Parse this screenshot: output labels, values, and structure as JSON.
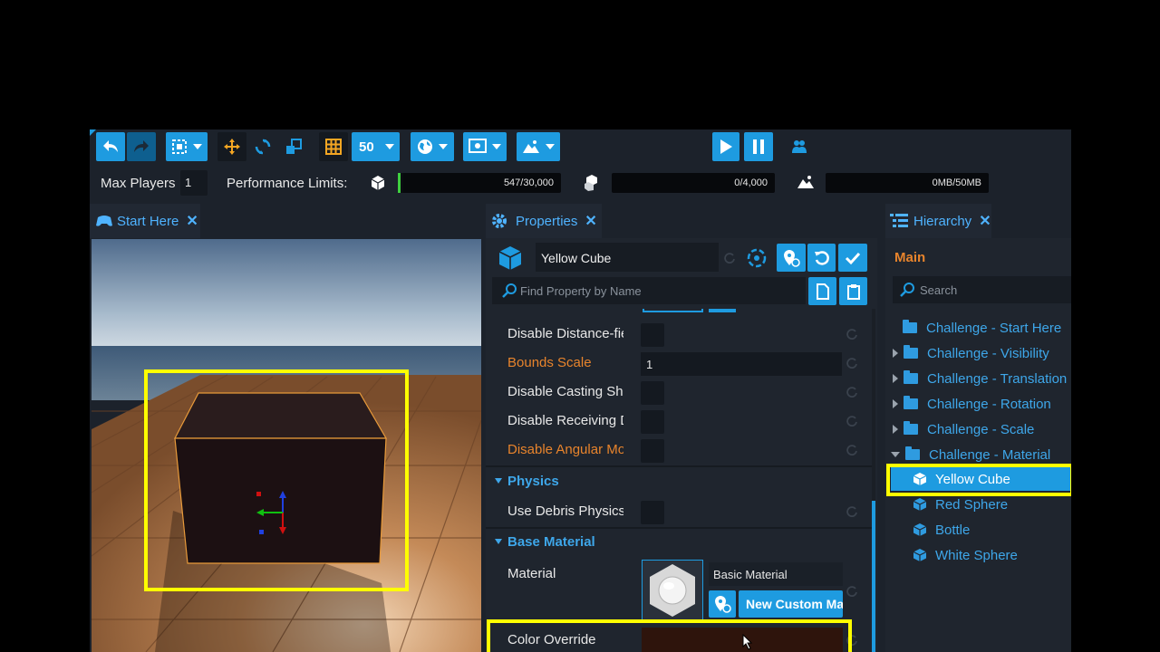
{
  "toolbar": {
    "grid_value": "50"
  },
  "perf": {
    "max_players_label": "Max Players",
    "max_players_value": "1",
    "limits_label": "Performance Limits:",
    "objects": "547/30,000",
    "objects_fill": 0.018,
    "networked": "0/4,000",
    "memory": "0MB/50MB"
  },
  "viewport_tab": {
    "label": "Start Here"
  },
  "properties_tab": {
    "label": "Properties",
    "object_name": "Yellow Cube",
    "search_placeholder": "Find Property by Name",
    "rows": {
      "disable_distance": "Disable Distance-fie",
      "bounds_scale": "Bounds Scale",
      "bounds_scale_value": "1",
      "disable_casting": "Disable Casting Sha",
      "disable_receiving": "Disable Receiving D",
      "disable_angular": "Disable Angular Mo",
      "use_debris": "Use Debris Physics",
      "material": "Material",
      "material_name": "Basic Material",
      "new_custom": "New Custom Ma",
      "color_override": "Color Override"
    },
    "sections": {
      "physics": "Physics",
      "base_material": "Base Material"
    },
    "color_override_value": "#2e140c"
  },
  "hierarchy": {
    "label": "Hierarchy",
    "root": "Main",
    "search_placeholder": "Search",
    "items": [
      "Challenge - Start Here",
      "Challenge - Visibility",
      "Challenge - Translation",
      "Challenge - Rotation",
      "Challenge - Scale",
      "Challenge - Material",
      "Yellow Cube",
      "Red Sphere",
      "Bottle",
      "White Sphere"
    ]
  },
  "colors": {
    "accent": "#1e9be0",
    "orange": "#e8842c",
    "highlight": "#ffff00",
    "panel": "#1c222b"
  }
}
